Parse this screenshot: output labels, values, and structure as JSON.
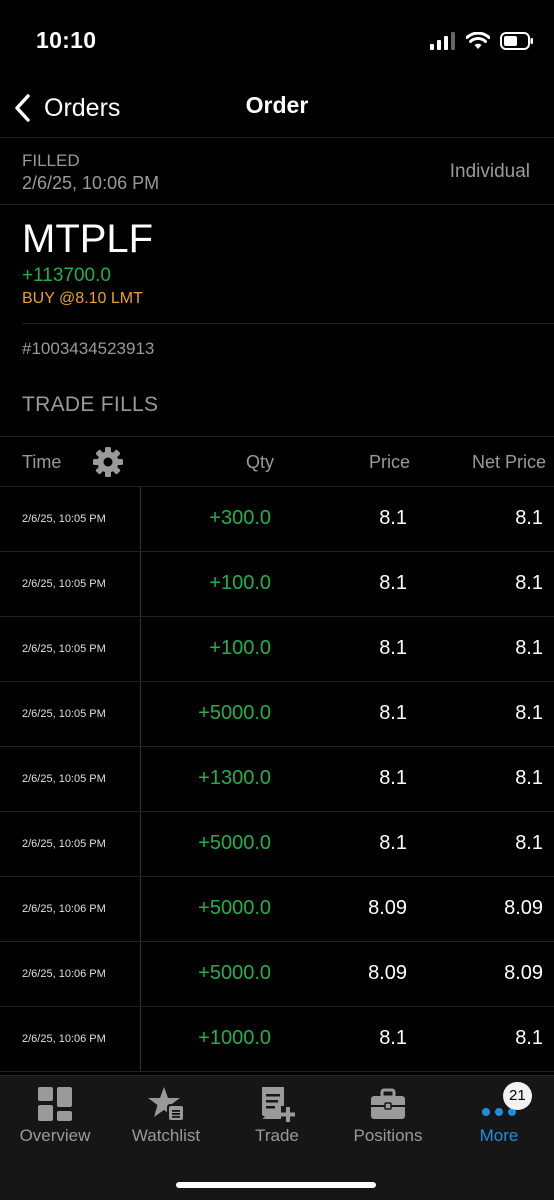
{
  "status_bar": {
    "time": "10:10"
  },
  "nav": {
    "back_label": "Orders",
    "title": "Order"
  },
  "order": {
    "status": "FILLED",
    "datetime": "2/6/25, 10:06 PM",
    "account": "Individual",
    "symbol": "MTPLF",
    "quantity": "+113700.0",
    "description": "BUY @8.10 LMT",
    "order_id": "#1003434523913"
  },
  "fills": {
    "section_title": "TRADE FILLS",
    "columns": {
      "time": "Time",
      "qty": "Qty",
      "price": "Price",
      "net_price": "Net Price"
    },
    "rows": [
      {
        "time": "2/6/25, 10:05 PM",
        "qty": "+300.0",
        "price": "8.1",
        "net_price": "8.1"
      },
      {
        "time": "2/6/25, 10:05 PM",
        "qty": "+100.0",
        "price": "8.1",
        "net_price": "8.1"
      },
      {
        "time": "2/6/25, 10:05 PM",
        "qty": "+100.0",
        "price": "8.1",
        "net_price": "8.1"
      },
      {
        "time": "2/6/25, 10:05 PM",
        "qty": "+5000.0",
        "price": "8.1",
        "net_price": "8.1"
      },
      {
        "time": "2/6/25, 10:05 PM",
        "qty": "+1300.0",
        "price": "8.1",
        "net_price": "8.1"
      },
      {
        "time": "2/6/25, 10:05 PM",
        "qty": "+5000.0",
        "price": "8.1",
        "net_price": "8.1"
      },
      {
        "time": "2/6/25, 10:06 PM",
        "qty": "+5000.0",
        "price": "8.09",
        "net_price": "8.09"
      },
      {
        "time": "2/6/25, 10:06 PM",
        "qty": "+5000.0",
        "price": "8.09",
        "net_price": "8.09"
      },
      {
        "time": "2/6/25, 10:06 PM",
        "qty": "+1000.0",
        "price": "8.1",
        "net_price": "8.1"
      }
    ]
  },
  "tabs": [
    {
      "label": "Overview",
      "icon": "overview-icon"
    },
    {
      "label": "Watchlist",
      "icon": "watchlist-icon"
    },
    {
      "label": "Trade",
      "icon": "trade-icon"
    },
    {
      "label": "Positions",
      "icon": "positions-icon"
    },
    {
      "label": "More",
      "icon": "more-icon",
      "badge": "21",
      "active": true
    }
  ],
  "colors": {
    "background": "#000000",
    "positive": "#22b04a",
    "order_desc": "#f0a020",
    "active_tab": "#1e8fe0",
    "muted_text": "#9a9a9a"
  }
}
